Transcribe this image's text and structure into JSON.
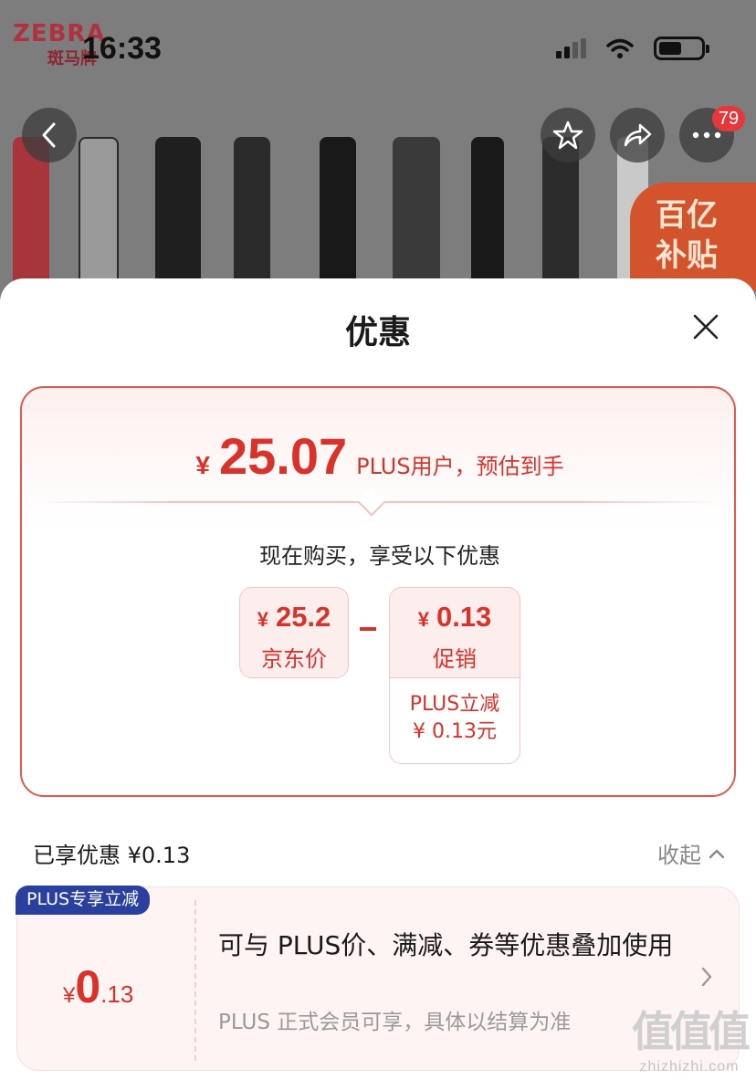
{
  "status_bar": {
    "time": "16:33"
  },
  "product_header": {
    "brand": "ZEBRA",
    "brand_sub": "斑马牌",
    "cart_count": "79",
    "subsidy_label_1": "百亿",
    "subsidy_label_2": "补贴",
    "icons": [
      "back-icon",
      "star-icon",
      "share-icon",
      "more-icon"
    ]
  },
  "sheet": {
    "title": "优惠",
    "estimate": {
      "currency": "¥",
      "value": "25.07",
      "label": "PLUS用户，预估到手"
    },
    "buy_now_text": "现在购买，享受以下优惠",
    "jd_price": {
      "currency": "¥",
      "value": "25.2",
      "label": "京东价"
    },
    "promo": {
      "currency": "¥",
      "value": "0.13",
      "label": "促销"
    },
    "plus_detail": {
      "line1": "PLUS立减",
      "line2": "¥ 0.13元"
    }
  },
  "enjoyed": {
    "label": "已享优惠 ¥0.13",
    "collapse": "收起"
  },
  "coupon": {
    "tag": "PLUS专享立减",
    "currency": "¥",
    "value_int": "0",
    "value_dec": ".13",
    "title": "可与 PLUS价、满减、券等优惠叠加使用",
    "desc": "PLUS 正式会员可享，具体以结算为准"
  },
  "watermark": {
    "site": "zhizhizhi.com",
    "logo_text": "值值值"
  },
  "colors": {
    "accent": "#d9322b",
    "plus_tag": "#2b3f9e",
    "card_border": "#e3584a"
  }
}
